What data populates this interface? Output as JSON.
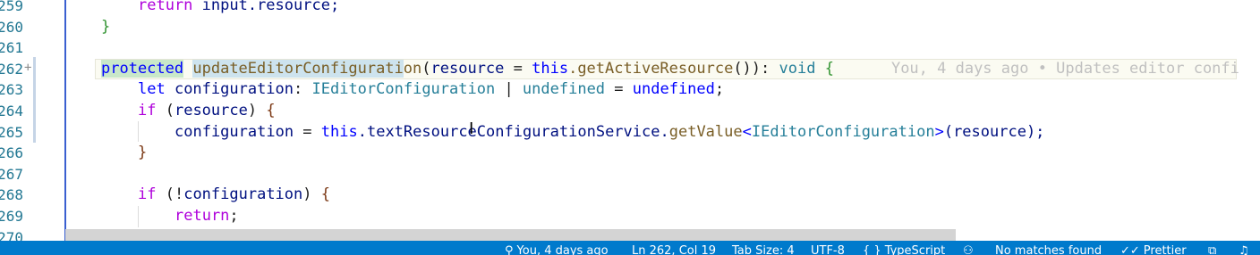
{
  "gutter": {
    "line_numbers": [
      "259",
      "260",
      "261",
      "262",
      "263",
      "264",
      "265",
      "266",
      "267",
      "268",
      "269",
      "270"
    ]
  },
  "code": {
    "l259": {
      "kw": "return",
      "rest": " input.resource;"
    },
    "l260": {
      "brace": "}"
    },
    "l262": {
      "kw": "protected",
      "fn_sel": "updateEditorConfigurati",
      "fn_rest": "on",
      "p1": "(",
      "param": "resource",
      "eq": " = ",
      "this": "this",
      "call": ".getActiveResource",
      "p2": "()",
      "p3": "): ",
      "rettype": "void",
      "brace": " {",
      "blame": "You, 4 days ago • Updates editor confi"
    },
    "l263": {
      "let": "let",
      "name": " configuration",
      "colon": ": ",
      "type": "IEditorConfiguration",
      "pipe": " | ",
      "undef1": "undefined",
      "eq": " = ",
      "undef2": "undefined",
      "semi": ";"
    },
    "l264": {
      "if": "if",
      "open": " (",
      "arg": "resource",
      "close": ") ",
      "brace": "{"
    },
    "l265": {
      "lhs": "configuration",
      "eq": " = ",
      "this": "this",
      "mid": ".textResourceConfigurationService.",
      "fn": "getValue",
      "lt": "<",
      "type": "IEditorConfiguration",
      "gt": ">",
      "args": "(resource);"
    },
    "l266": {
      "brace": "}"
    },
    "l268": {
      "if": "if",
      "open": " (!",
      "arg": "configuration",
      "close": ") ",
      "brace": "{"
    },
    "l269": {
      "kw": "return",
      "semi": ";"
    },
    "l270": {
      "brace": "}"
    }
  },
  "statusbar": {
    "blame": "You, 4 days ago",
    "position": "Ln 262, Col 19",
    "tab_size": "Tab Size: 4",
    "encoding": "UTF-8",
    "language": "TypeScript",
    "find": "No matches found",
    "prettier": "Prettier"
  }
}
